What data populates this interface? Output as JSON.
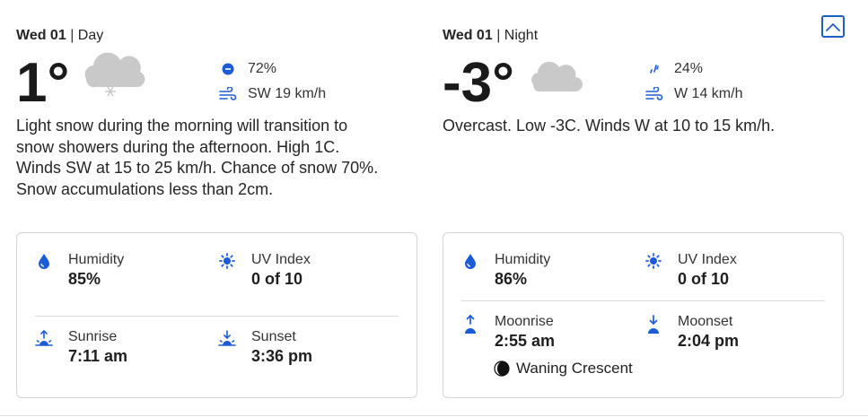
{
  "day": {
    "date": "Wed 01",
    "separator": "|",
    "period": "Day",
    "temperature": "1°",
    "condition_icon": "snow-cloud-icon",
    "precipitation": "72%",
    "wind": "SW 19 km/h",
    "summary": "Light snow during the morning will transition to snow showers during the afternoon. High 1C. Winds SW at 15 to 25 km/h. Chance of snow 70%. Snow accumulations less than 2cm.",
    "details": {
      "humidity_label": "Humidity",
      "humidity_value": "85%",
      "uv_label": "UV Index",
      "uv_value": "0 of 10",
      "sunrise_label": "Sunrise",
      "sunrise_value": "7:11 am",
      "sunset_label": "Sunset",
      "sunset_value": "3:36 pm"
    }
  },
  "night": {
    "date": "Wed 01",
    "separator": "|",
    "period": "Night",
    "temperature": "-3°",
    "condition_icon": "cloud-icon",
    "precipitation": "24%",
    "wind": "W 14 km/h",
    "summary": "Overcast. Low -3C. Winds W at 10 to 15 km/h.",
    "details": {
      "humidity_label": "Humidity",
      "humidity_value": "86%",
      "uv_label": "UV Index",
      "uv_value": "0 of 10",
      "moonrise_label": "Moonrise",
      "moonrise_value": "2:55 am",
      "moonset_label": "Moonset",
      "moonset_value": "2:04 pm",
      "moon_phase": "Waning Crescent"
    }
  },
  "colors": {
    "accent": "#1f5fc4",
    "icon_blue": "#1c5bd6",
    "cloud_gray": "#c8c8c8",
    "border": "#d6d6d6"
  }
}
